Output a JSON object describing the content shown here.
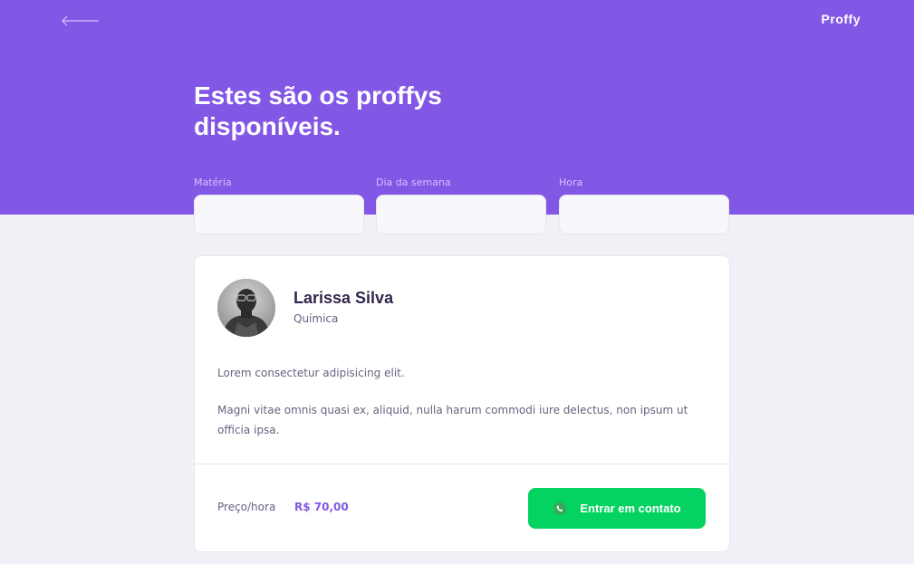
{
  "header": {
    "logo": "Proffy",
    "back_icon": "arrow-left-icon",
    "title": "Estes são os proffys disponíveis."
  },
  "filters": {
    "subject_label": "Matéria",
    "weekday_label": "Dia da semana",
    "time_label": "Hora",
    "subject_value": "",
    "weekday_value": "",
    "time_value": ""
  },
  "teacher": {
    "name": "Larissa Silva",
    "subject": "Química",
    "avatar_icon": "avatar-photo",
    "bio_1": "Lorem consectetur adipisicing elit.",
    "bio_2": "Magni vitae omnis quasi ex, aliquid, nulla harum commodi iure delectus, non ipsum ut officia ipsa.",
    "price_label": "Preço/hora",
    "price_value": "R$ 70,00",
    "contact_label": "Entrar em contato",
    "contact_icon": "whatsapp-icon"
  },
  "colors": {
    "primary": "#8257E5",
    "background": "#F0F0F7",
    "secondary": "#04D361",
    "title_text": "#32264D",
    "body_text": "#6A6180"
  }
}
